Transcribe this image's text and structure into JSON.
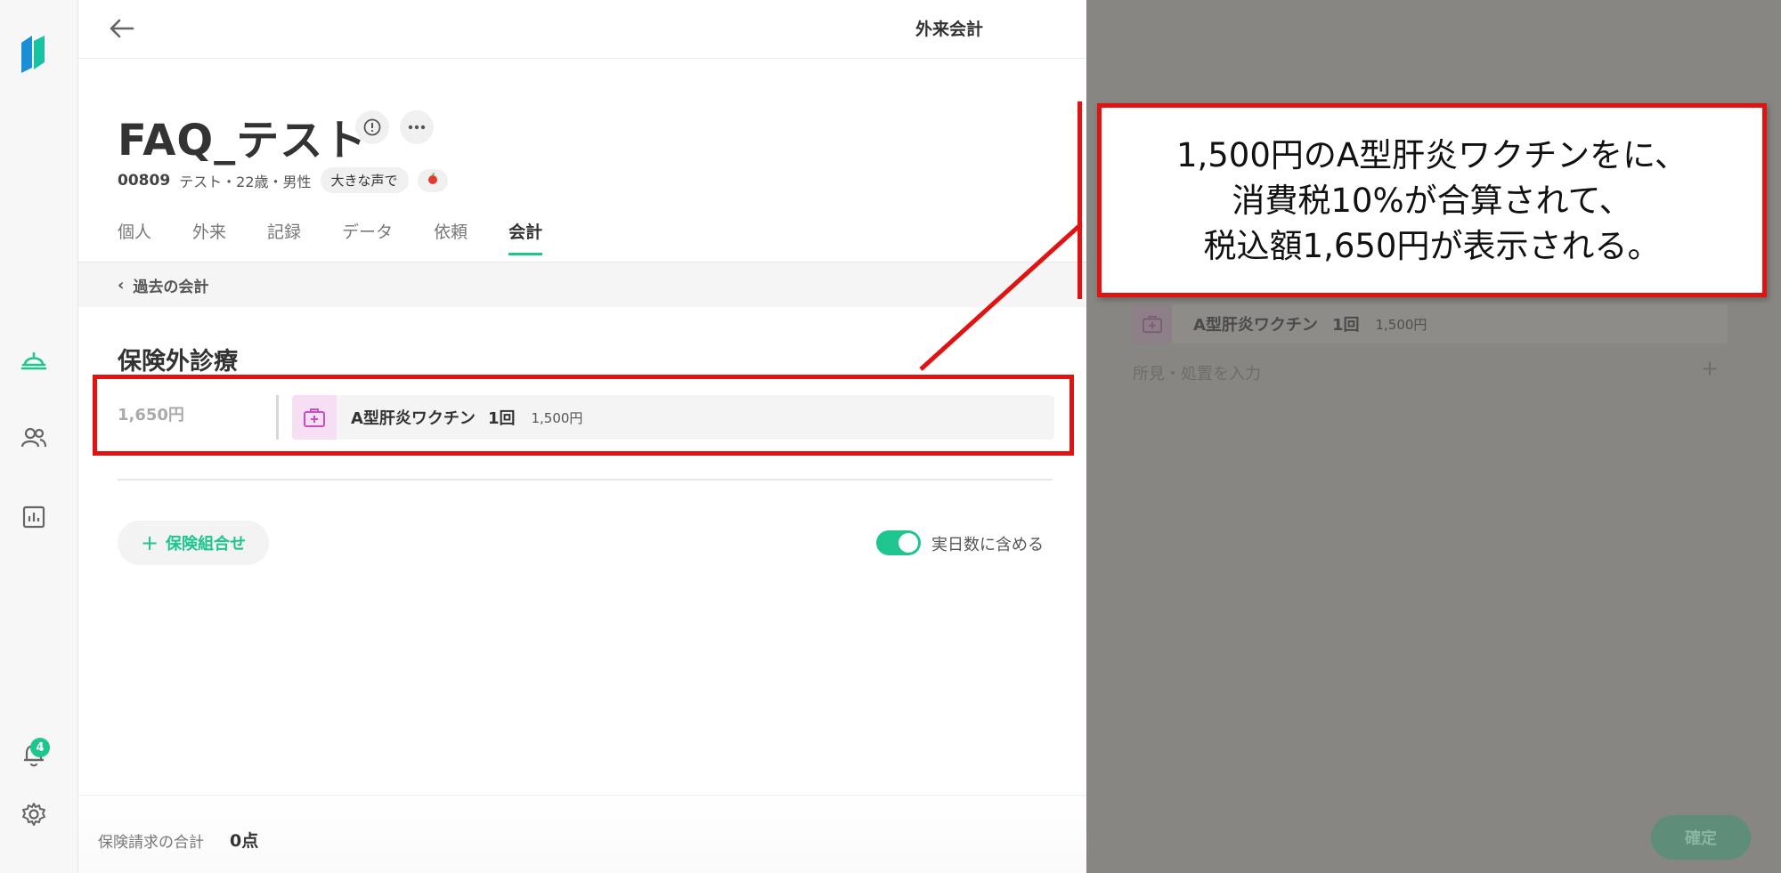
{
  "header": {
    "title": "外来会計"
  },
  "patient": {
    "name": "FAQ_テスト",
    "id": "00809",
    "meta": "テスト・22歳・男性",
    "tag": "大きな声で",
    "tag_icon": "apple-icon"
  },
  "tabs": [
    {
      "label": "個人",
      "active": false
    },
    {
      "label": "外来",
      "active": false
    },
    {
      "label": "記録",
      "active": false
    },
    {
      "label": "データ",
      "active": false
    },
    {
      "label": "依頼",
      "active": false
    },
    {
      "label": "会計",
      "active": true
    }
  ],
  "past_billing": {
    "label": "過去の会計"
  },
  "section": {
    "title": "保険外診療",
    "row": {
      "total": "1,650円",
      "item_name": "A型肝炎ワクチン",
      "item_qty": "1回",
      "item_price": "1,500円"
    }
  },
  "actions": {
    "insurance_combo": "保険組合せ",
    "toggle_label": "実日数に含める",
    "toggle_on": true
  },
  "footer": {
    "label": "保険請求の合計",
    "value": "0点"
  },
  "rail": {
    "notification_count": "4"
  },
  "overlay": {
    "item_name": "A型肝炎ワクチン",
    "item_qty": "1回",
    "item_price": "1,500円",
    "input_placeholder": "所見・処置を入力",
    "confirm": "確定"
  },
  "callout": {
    "line1": "1,500円のA型肝炎ワクチンをに、",
    "line2": "消費税10%が合算されて、",
    "line3": "税込額1,650円が表示される。"
  },
  "colors": {
    "accent": "#1ec58e",
    "annotation": "#e01212",
    "overlay": "#878682"
  }
}
